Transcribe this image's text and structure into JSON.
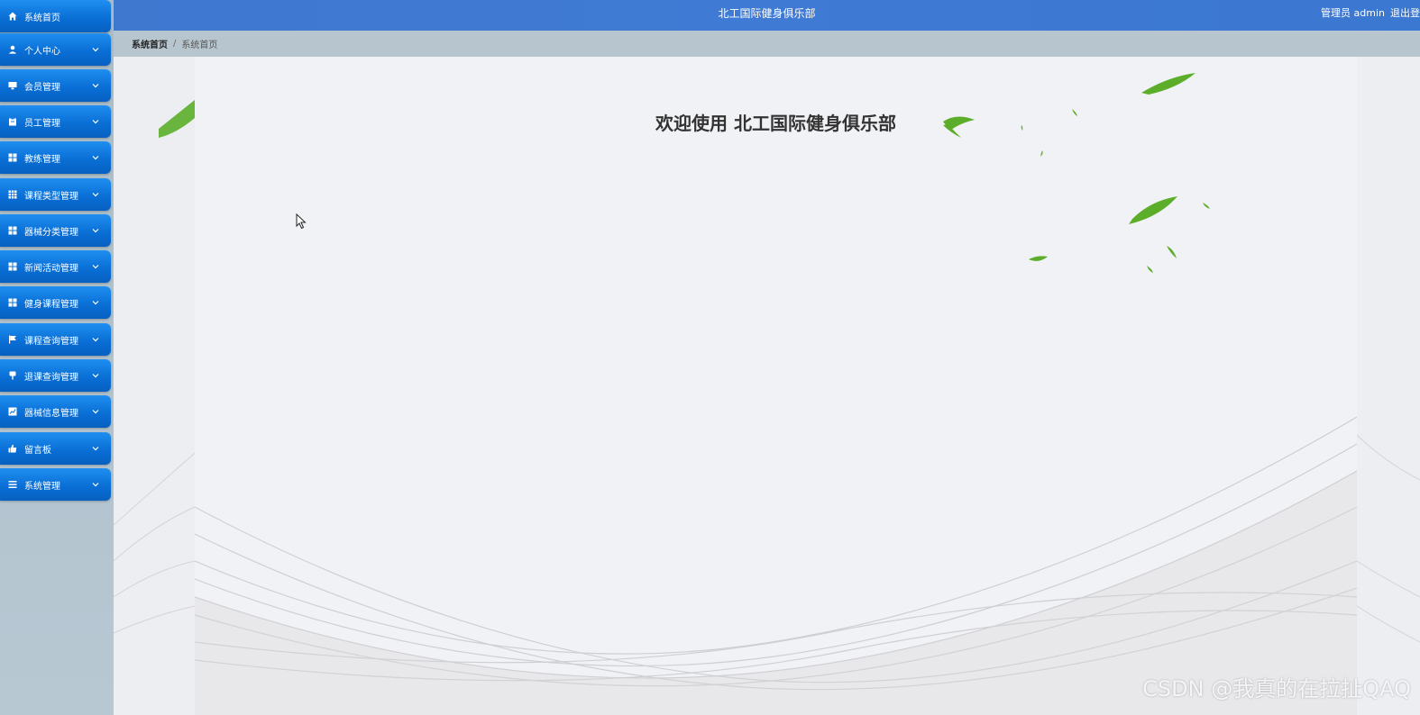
{
  "header": {
    "title": "北工国际健身俱乐部",
    "user_label": "管理员 admin",
    "logout_label": "退出登"
  },
  "breadcrumb": {
    "home": "系统首页",
    "separator": "/",
    "current": "系统首页"
  },
  "sidebar": {
    "items": [
      {
        "label": "系统首页",
        "icon": "home-icon",
        "expandable": false
      },
      {
        "label": "个人中心",
        "icon": "user-icon",
        "expandable": true
      },
      {
        "label": "会员管理",
        "icon": "monitor-icon",
        "expandable": true
      },
      {
        "label": "员工管理",
        "icon": "clipboard-icon",
        "expandable": true
      },
      {
        "label": "教练管理",
        "icon": "grid-icon",
        "expandable": true
      },
      {
        "label": "课程类型管理",
        "icon": "table-icon",
        "expandable": true
      },
      {
        "label": "器械分类管理",
        "icon": "grid-icon",
        "expandable": true
      },
      {
        "label": "新闻活动管理",
        "icon": "grid-icon",
        "expandable": true
      },
      {
        "label": "健身课程管理",
        "icon": "grid-icon",
        "expandable": true
      },
      {
        "label": "课程查询管理",
        "icon": "flag-icon",
        "expandable": true
      },
      {
        "label": "退课查询管理",
        "icon": "pin-icon",
        "expandable": true
      },
      {
        "label": "器械信息管理",
        "icon": "chart-icon",
        "expandable": true
      },
      {
        "label": "留言板",
        "icon": "thumbs-up-icon",
        "expandable": true
      },
      {
        "label": "系统管理",
        "icon": "list-icon",
        "expandable": true
      }
    ]
  },
  "main": {
    "welcome": "欢迎使用 北工国际健身俱乐部"
  },
  "watermark": "CSDN @我真的在拉扯QAQ",
  "colors": {
    "header": "#3f78cf",
    "menu_item": "#0a6fd6",
    "breadcrumb_bg": "#b7c5cf",
    "leaf": "#5cae2a"
  }
}
